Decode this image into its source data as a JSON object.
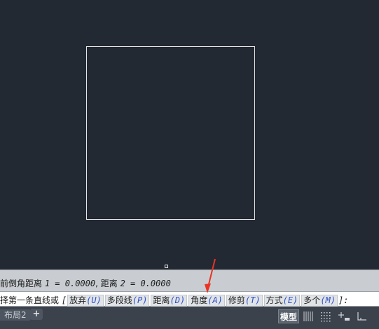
{
  "command_history": {
    "line1_prefix": "前倒角距离",
    "line1_values": "1 = 0.0000",
    "line1_mid": ", 距离",
    "line1_values2": "2 = 0.0000"
  },
  "command_prompt": {
    "text": "择第一条直线或",
    "open_bracket": "[",
    "options": [
      {
        "label": "放弃",
        "key": "(U)"
      },
      {
        "label": "多段线",
        "key": "(P)"
      },
      {
        "label": "距离",
        "key": "(D)"
      },
      {
        "label": "角度",
        "key": "(A)"
      },
      {
        "label": "修剪",
        "key": "(T)"
      },
      {
        "label": "方式",
        "key": "(E)"
      },
      {
        "label": "多个",
        "key": "(M)"
      }
    ],
    "close": "]:"
  },
  "status_bar": {
    "layout_tab": "布局2",
    "add_tab": "+",
    "model_label": "模型"
  },
  "colors": {
    "canvas": "#222933",
    "geometry": "#e6e6e6",
    "annotation_arrow": "#ea3323",
    "option_key": "#2f4fc8"
  }
}
